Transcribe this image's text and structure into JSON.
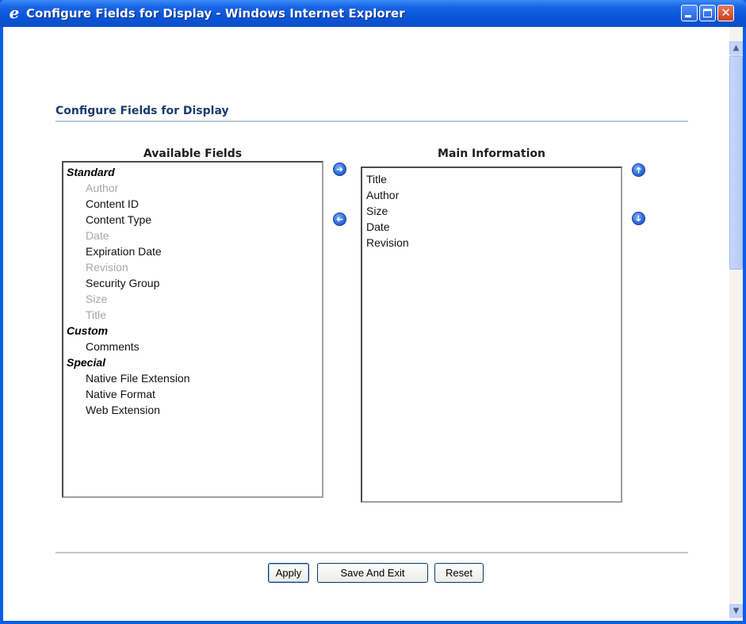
{
  "window": {
    "title": "Configure Fields for Display - Windows Internet Explorer",
    "app_icon": "ie-icon",
    "controls": [
      "minimize-icon",
      "maximize-icon",
      "close-icon"
    ]
  },
  "page": {
    "heading": "Configure Fields for Display"
  },
  "available": {
    "title": "Available Fields",
    "groups": [
      {
        "label": "Standard",
        "items": [
          {
            "label": "Author",
            "disabled": true
          },
          {
            "label": "Content ID",
            "disabled": false
          },
          {
            "label": "Content Type",
            "disabled": false
          },
          {
            "label": "Date",
            "disabled": true
          },
          {
            "label": "Expiration Date",
            "disabled": false
          },
          {
            "label": "Revision",
            "disabled": true
          },
          {
            "label": "Security Group",
            "disabled": false
          },
          {
            "label": "Size",
            "disabled": true
          },
          {
            "label": "Title",
            "disabled": true
          }
        ]
      },
      {
        "label": "Custom",
        "items": [
          {
            "label": "Comments",
            "disabled": false
          }
        ]
      },
      {
        "label": "Special",
        "items": [
          {
            "label": "Native File Extension",
            "disabled": false
          },
          {
            "label": "Native Format",
            "disabled": false
          },
          {
            "label": "Web Extension",
            "disabled": false
          }
        ]
      }
    ]
  },
  "main": {
    "title": "Main Information",
    "items": [
      "Title",
      "Author",
      "Size",
      "Date",
      "Revision"
    ]
  },
  "arrows": {
    "add": "arrow-right-icon",
    "remove": "arrow-left-icon",
    "move_up": "arrow-up-icon",
    "move_down": "arrow-down-icon"
  },
  "buttons": {
    "apply": "Apply",
    "save_exit": "Save And Exit",
    "reset": "Reset"
  },
  "colors": {
    "titlebar": "#0a55d9",
    "heading": "#1a3b6e",
    "disabled_text": "#a6a6a6"
  }
}
